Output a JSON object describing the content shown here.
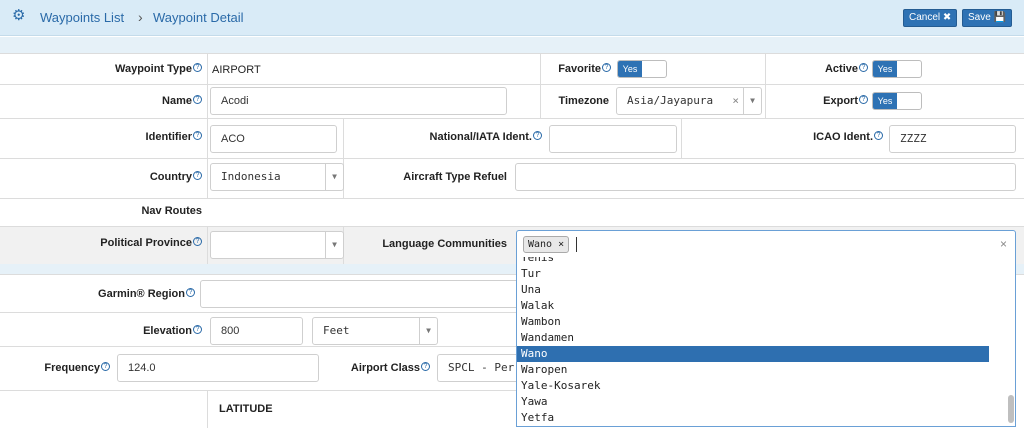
{
  "header": {
    "crumb_list": "Waypoints List",
    "crumb_sep": "›",
    "crumb_detail": "Waypoint Detail",
    "cancel_label": "Cancel",
    "save_label": "Save",
    "cancel_icon": "✖",
    "save_icon": "💾"
  },
  "icons": {
    "gear": "gear-icon",
    "help": "help-circle-icon",
    "arrow": "chevron-down-icon",
    "clear": "close-icon"
  },
  "glyphs": {
    "help": "?",
    "arrow": "▼",
    "clear": "×"
  },
  "fields": {
    "waypoint_type": {
      "label": "Waypoint Type",
      "value": "AIRPORT"
    },
    "favorite": {
      "label": "Favorite",
      "value": "Yes"
    },
    "active": {
      "label": "Active",
      "value": "Yes"
    },
    "name": {
      "label": "Name",
      "value": "Acodi"
    },
    "timezone": {
      "label": "Timezone",
      "value": "Asia/Jayapura"
    },
    "export": {
      "label": "Export",
      "value": "Yes"
    },
    "identifier": {
      "label": "Identifier",
      "value": "ACO"
    },
    "national_iata": {
      "label": "National/IATA Ident.",
      "value": ""
    },
    "icao": {
      "label": "ICAO Ident.",
      "value": "ZZZZ"
    },
    "country": {
      "label": "Country",
      "value": "Indonesia"
    },
    "aircraft_type_refuel": {
      "label": "Aircraft Type Refuel",
      "value": ""
    },
    "nav_routes": {
      "label": "Nav Routes"
    },
    "political_province": {
      "label": "Political Province",
      "value": ""
    },
    "language_communities": {
      "label": "Language Communities",
      "tag": "Wano"
    },
    "garmin_region": {
      "label": "Garmin® Region",
      "value": ""
    },
    "elevation": {
      "label": "Elevation",
      "value": "800",
      "unit": "Feet"
    },
    "frequency": {
      "label": "Frequency",
      "value": "124.0"
    },
    "airport_class": {
      "label": "Airport Class",
      "value": "SPCL - Per"
    },
    "latitude": {
      "label": "LATITUDE"
    }
  },
  "dropdown": {
    "options": [
      "Yenis",
      "Tur",
      "Una",
      "Walak",
      "Wambon",
      "Wandamen",
      "Wano",
      "Waropen",
      "Yale-Kosarek",
      "Yawa",
      "Yetfa"
    ],
    "highlighted": "Wano"
  },
  "colors": {
    "accent": "#2e72b4",
    "header_bg": "#d9ebf7",
    "highlight": "#2e6fb0"
  }
}
